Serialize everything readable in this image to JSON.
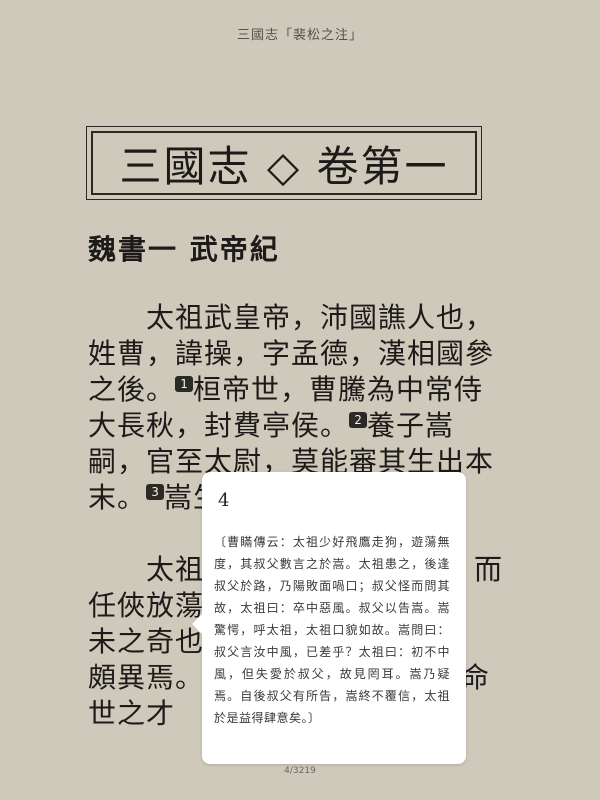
{
  "header": {
    "title": "三國志「裴松之注」"
  },
  "chapter": {
    "title": "三國志 ◇ 卷第一"
  },
  "section": {
    "heading": "魏書一 武帝紀"
  },
  "body": {
    "p1_a": "　　太祖武皇帝，沛國譙人也，姓曹，諱操，字孟德，漢相國參之後。",
    "fn1": "1",
    "p1_b": "桓帝世，曹騰為中常侍大長秋，封費亭侯。",
    "fn2": "2",
    "p1_c": "養子嵩嗣，官至太尉，莫能審其生出本末。",
    "fn3": "3",
    "p1_d": "嵩生太祖。",
    "p2_a": "　　太祖",
    "p2_b": "而任俠放蕩，",
    "p2_c": "未之奇也；",
    "fn4": "4",
    "p2_d": "頗異焉。玄謂",
    "p2_e": "非命世之才",
    "p2_f": "者，"
  },
  "popup": {
    "number": "4",
    "text": "〔曹瞞傳云：太祖少好飛鷹走狗，遊蕩無度，其叔父數言之於嵩。太祖患之，後逢叔父於路，乃陽敗面喎口；叔父怪而問其故，太祖曰：卒中惡風。叔父以告嵩。嵩驚愕，呼太祖，太祖口貌如故。嵩問曰：叔父言汝中風，已差乎？太祖曰：初不中風，但失愛於叔父，故見罔耳。嵩乃疑焉。自後叔父有所告，嵩終不覆信，太祖於是益得肆意矣。〕"
  },
  "footer": {
    "page_indicator": "4/3219"
  }
}
